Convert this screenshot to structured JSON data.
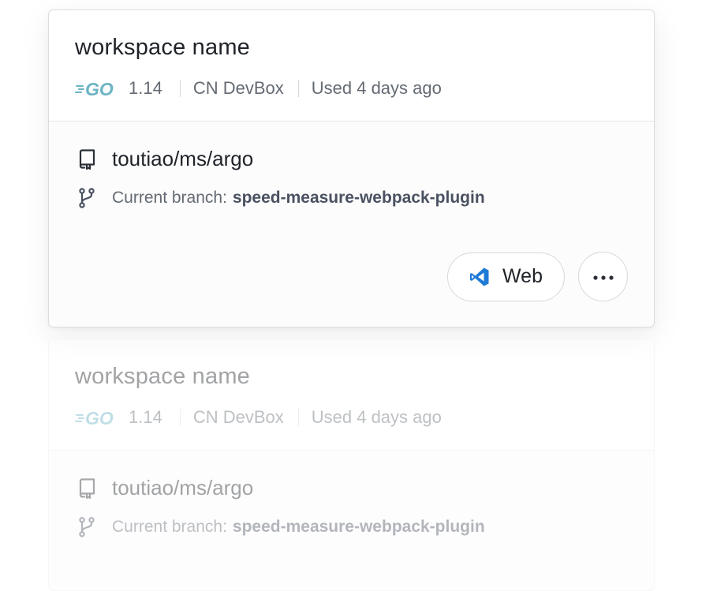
{
  "workspaces": [
    {
      "name": "workspace name",
      "language_icon": "go-logo-icon",
      "version": "1.14",
      "devbox": "CN DevBox",
      "last_used": "Used 4 days ago",
      "repo": "toutiao/ms/argo",
      "branch_label": "Current branch:",
      "branch": "speed-measure-webpack-plugin",
      "open_label": "Web"
    },
    {
      "name": "workspace name",
      "language_icon": "go-logo-icon",
      "version": "1.14",
      "devbox": "CN DevBox",
      "last_used": "Used 4 days ago",
      "repo": "toutiao/ms/argo",
      "branch_label": "Current branch:",
      "branch": "speed-measure-webpack-plugin"
    }
  ],
  "colors": {
    "go_brand": "#6cb4c4",
    "vscode_blue": "#1f7ad6",
    "text_primary": "#1f2329",
    "text_secondary": "#646a73"
  }
}
